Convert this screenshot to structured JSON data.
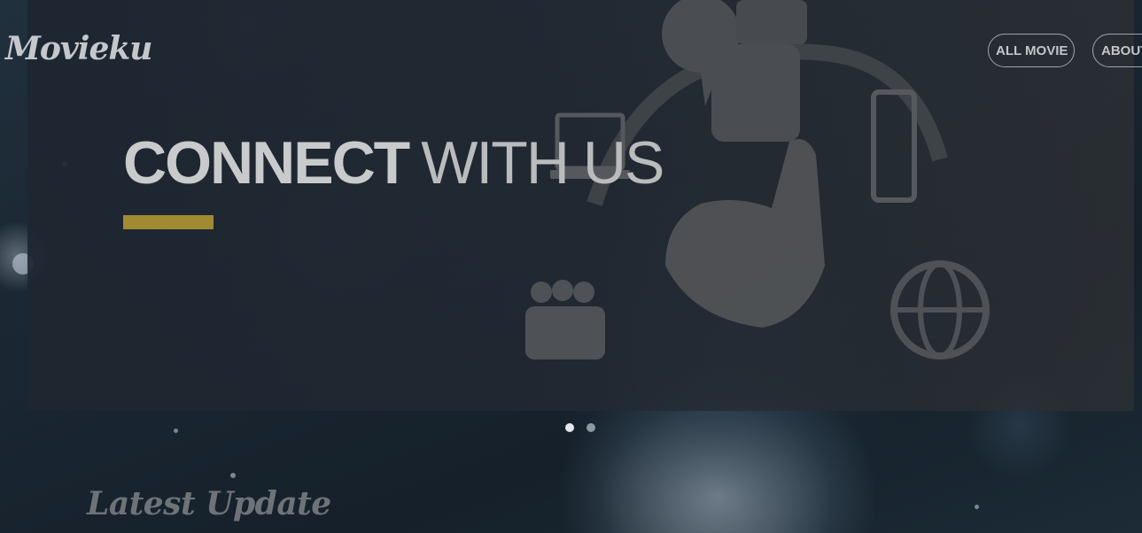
{
  "header": {
    "logo": "Movieku",
    "nav": [
      {
        "label": "ALL MOVIE"
      },
      {
        "label": "ABOUT"
      }
    ]
  },
  "carousel": {
    "slide": {
      "title_bold": "CONNECT",
      "title_light": "WITH US",
      "accent_color": "#a08a32"
    },
    "dots": [
      {
        "active": true
      },
      {
        "active": false
      }
    ]
  },
  "main": {
    "section_heading": "Latest Update"
  }
}
